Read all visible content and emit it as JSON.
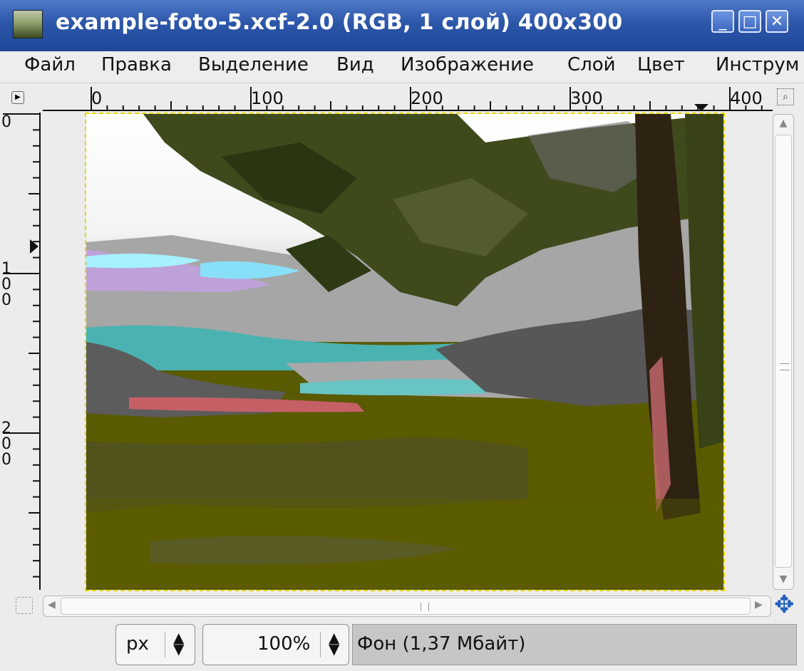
{
  "window": {
    "title": "example-foto-5.xcf-2.0 (RGB, 1 слой) 400x300",
    "buttons": {
      "minimize": "_",
      "maximize": "□",
      "close": "✕"
    }
  },
  "menu": [
    {
      "label": "Файл"
    },
    {
      "label": "Правка"
    },
    {
      "label": "Выделение"
    },
    {
      "label": "Вид"
    },
    {
      "label": "Изображение"
    },
    {
      "label": "Слой"
    },
    {
      "label": "Цвет"
    },
    {
      "label": "Инструм"
    }
  ],
  "rulers": {
    "horizontal_labels": [
      "0",
      "100",
      "200",
      "300",
      "400"
    ],
    "vertical_labels": [
      "0",
      "100",
      "200"
    ]
  },
  "statusbar": {
    "unit": "px",
    "zoom": "100%",
    "layer_info": "Фон (1,37 Мбайт)"
  },
  "colors": {
    "titlebar": "#2c56a8",
    "selection_outline": "#e6d600",
    "status_background": "#c6c6c6"
  },
  "icons": {
    "app": "gimp-wilber-icon",
    "ruler_menu": "triangle-right-icon",
    "zoom": "magnifier-icon",
    "quick_mask": "quick-mask-icon",
    "navigate": "four-way-arrow-icon"
  }
}
